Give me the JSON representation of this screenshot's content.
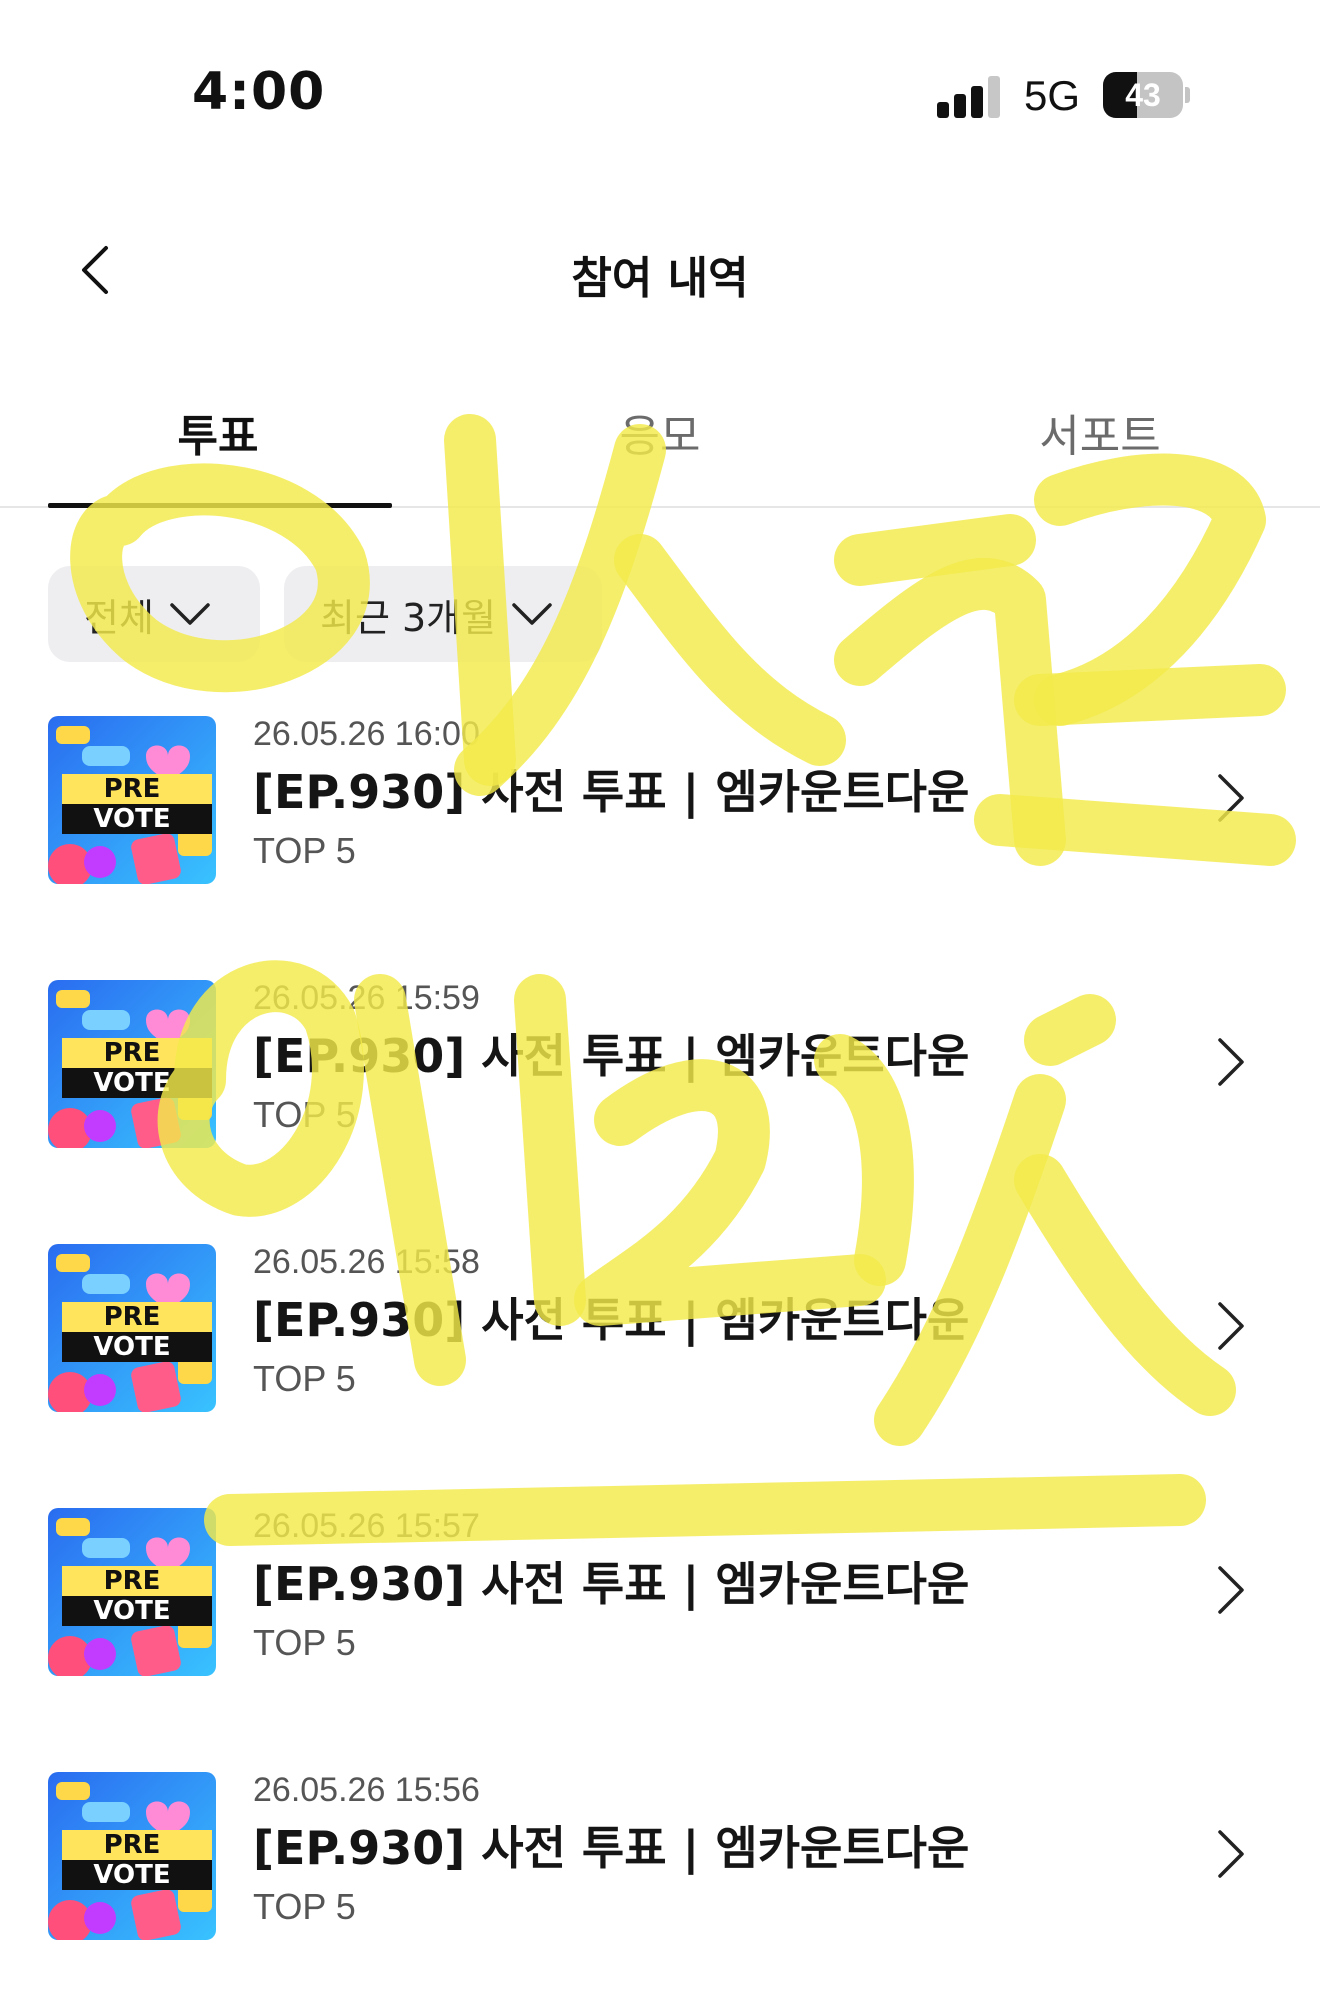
{
  "status_bar": {
    "time": "4:00",
    "network": "5G",
    "battery_percent": "43",
    "battery_level": 0.43,
    "signal_bars_active": 3
  },
  "header": {
    "back_icon": "chevron-left-icon",
    "title": "참여 내역"
  },
  "tabs": [
    {
      "label": "투표",
      "active": true
    },
    {
      "label": "응모",
      "active": false
    },
    {
      "label": "서포트",
      "active": false
    }
  ],
  "filters": {
    "type": {
      "label": "전체",
      "icon": "chevron-down-icon"
    },
    "period": {
      "label": "최근 3개월",
      "icon": "chevron-down-icon"
    }
  },
  "items": [
    {
      "date": "26.05.26 16:00",
      "title": "[EP.930] 사전 투표 | 엠카운트다운",
      "sub": "TOP 5",
      "thumb_text": [
        "PRE",
        "VOTE"
      ]
    },
    {
      "date": "26.05.26 15:59",
      "title": "[EP.930] 사전 투표 | 엠카운트다운",
      "sub": "TOP 5",
      "thumb_text": [
        "PRE",
        "VOTE"
      ]
    },
    {
      "date": "26.05.26 15:58",
      "title": "[EP.930] 사전 투표 | 엠카운트다운",
      "sub": "TOP 5",
      "thumb_text": [
        "PRE",
        "VOTE"
      ]
    },
    {
      "date": "26.05.26 15:57",
      "title": "[EP.930] 사전 투표 | 엠카운트다운",
      "sub": "TOP 5",
      "thumb_text": [
        "PRE",
        "VOTE"
      ]
    },
    {
      "date": "26.05.26 15:56",
      "title": "[EP.930] 사전 투표 | 엠카운트다운",
      "sub": "TOP 5",
      "thumb_text": [
        "PRE",
        "VOTE"
      ]
    }
  ],
  "colors": {
    "accent": "#111111",
    "chip_bg": "#eeeef1",
    "overlay_highlight": "#f3ea4a"
  }
}
